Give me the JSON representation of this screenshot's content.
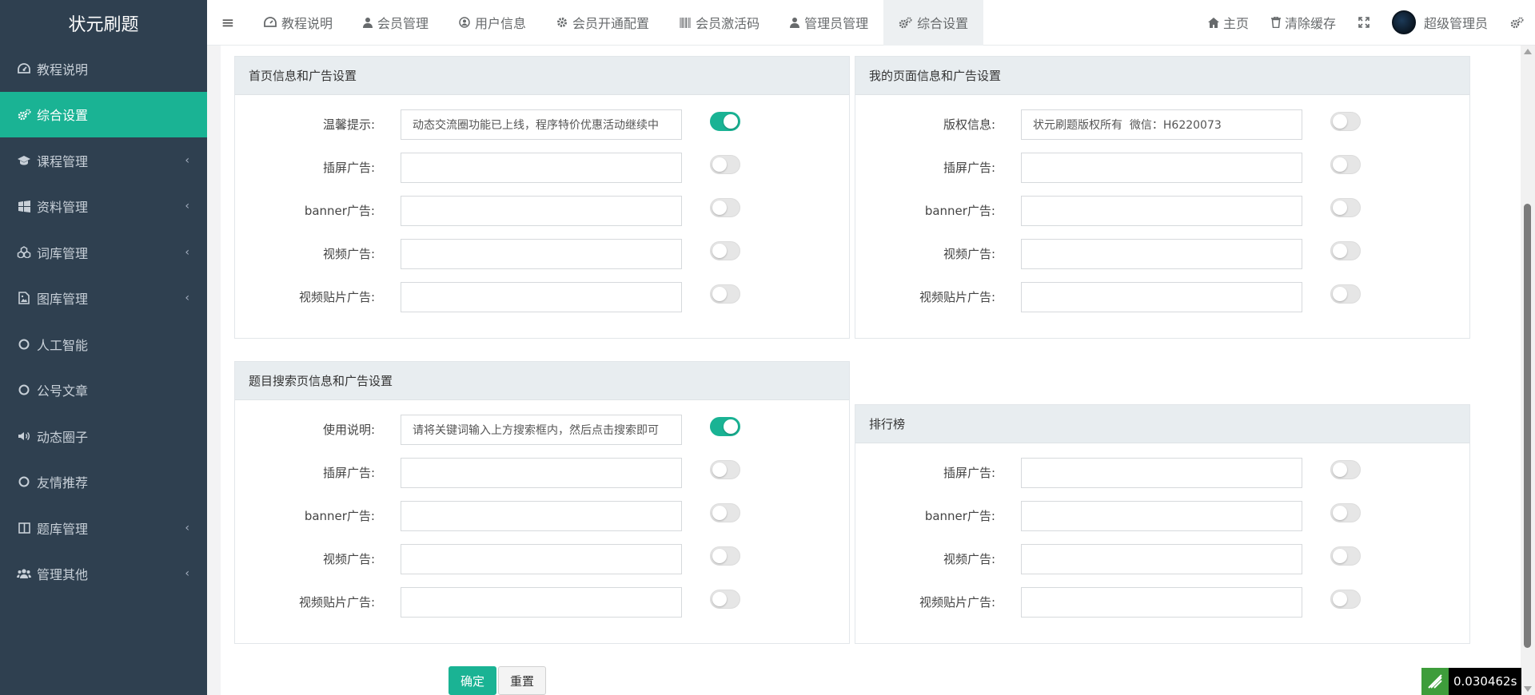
{
  "brand": "状元刷题",
  "sidebar": {
    "items": [
      {
        "label": "教程说明",
        "icon": "dashboard-icon"
      },
      {
        "label": "综合设置",
        "icon": "cogs-icon"
      },
      {
        "label": "课程管理",
        "icon": "graduation-cap-icon"
      },
      {
        "label": "资料管理",
        "icon": "windows-icon"
      },
      {
        "label": "词库管理",
        "icon": "cubes-icon"
      },
      {
        "label": "图库管理",
        "icon": "image-icon"
      },
      {
        "label": "人工智能",
        "icon": "circle-icon"
      },
      {
        "label": "公号文章",
        "icon": "circle-icon"
      },
      {
        "label": "动态圈子",
        "icon": "volume-icon"
      },
      {
        "label": "友情推荐",
        "icon": "circle-icon"
      },
      {
        "label": "题库管理",
        "icon": "columns-icon"
      },
      {
        "label": "管理其他",
        "icon": "users-icon"
      }
    ]
  },
  "topbar": {
    "tabs": [
      {
        "label": "教程说明",
        "icon": "dashboard-icon"
      },
      {
        "label": "会员管理",
        "icon": "user-icon"
      },
      {
        "label": "用户信息",
        "icon": "user-circle-icon"
      },
      {
        "label": "会员开通配置",
        "icon": "gear-icon"
      },
      {
        "label": "会员激活码",
        "icon": "barcode-icon"
      },
      {
        "label": "管理员管理",
        "icon": "user-icon"
      },
      {
        "label": "综合设置",
        "icon": "cogs-icon"
      }
    ],
    "home": "主页",
    "clear_cache": "清除缓存",
    "user_name": "超级管理员"
  },
  "panels": {
    "home": {
      "title": "首页信息和广告设置",
      "rows": [
        {
          "label": "温馨提示:",
          "value": "动态交流圈功能已上线，程序特价优惠活动继续中",
          "on": true
        },
        {
          "label": "插屏广告:",
          "value": "",
          "on": false
        },
        {
          "label": "banner广告:",
          "value": "",
          "on": false
        },
        {
          "label": "视频广告:",
          "value": "",
          "on": false
        },
        {
          "label": "视频贴片广告:",
          "value": "",
          "on": false
        }
      ]
    },
    "mine": {
      "title": "我的页面信息和广告设置",
      "rows": [
        {
          "label": "版权信息:",
          "value": "状元刷题版权所有  微信：H6220073",
          "on": false
        },
        {
          "label": "插屏广告:",
          "value": "",
          "on": false
        },
        {
          "label": "banner广告:",
          "value": "",
          "on": false
        },
        {
          "label": "视频广告:",
          "value": "",
          "on": false
        },
        {
          "label": "视频贴片广告:",
          "value": "",
          "on": false
        }
      ]
    },
    "search": {
      "title": "题目搜索页信息和广告设置",
      "rows": [
        {
          "label": "使用说明:",
          "value": "请将关键词输入上方搜索框内，然后点击搜索即可",
          "on": true
        },
        {
          "label": "插屏广告:",
          "value": "",
          "on": false
        },
        {
          "label": "banner广告:",
          "value": "",
          "on": false
        },
        {
          "label": "视频广告:",
          "value": "",
          "on": false
        },
        {
          "label": "视频贴片广告:",
          "value": "",
          "on": false
        }
      ]
    },
    "rank": {
      "title": "排行榜",
      "rows": [
        {
          "label": "插屏广告:",
          "value": "",
          "on": false
        },
        {
          "label": "banner广告:",
          "value": "",
          "on": false
        },
        {
          "label": "视频广告:",
          "value": "",
          "on": false
        },
        {
          "label": "视频贴片广告:",
          "value": "",
          "on": false
        }
      ]
    }
  },
  "buttons": {
    "confirm": "确定",
    "reset": "重置"
  },
  "timer": "0.030462s",
  "colors": {
    "sidebar_bg": "#2f4050",
    "accent": "#1ab394"
  }
}
